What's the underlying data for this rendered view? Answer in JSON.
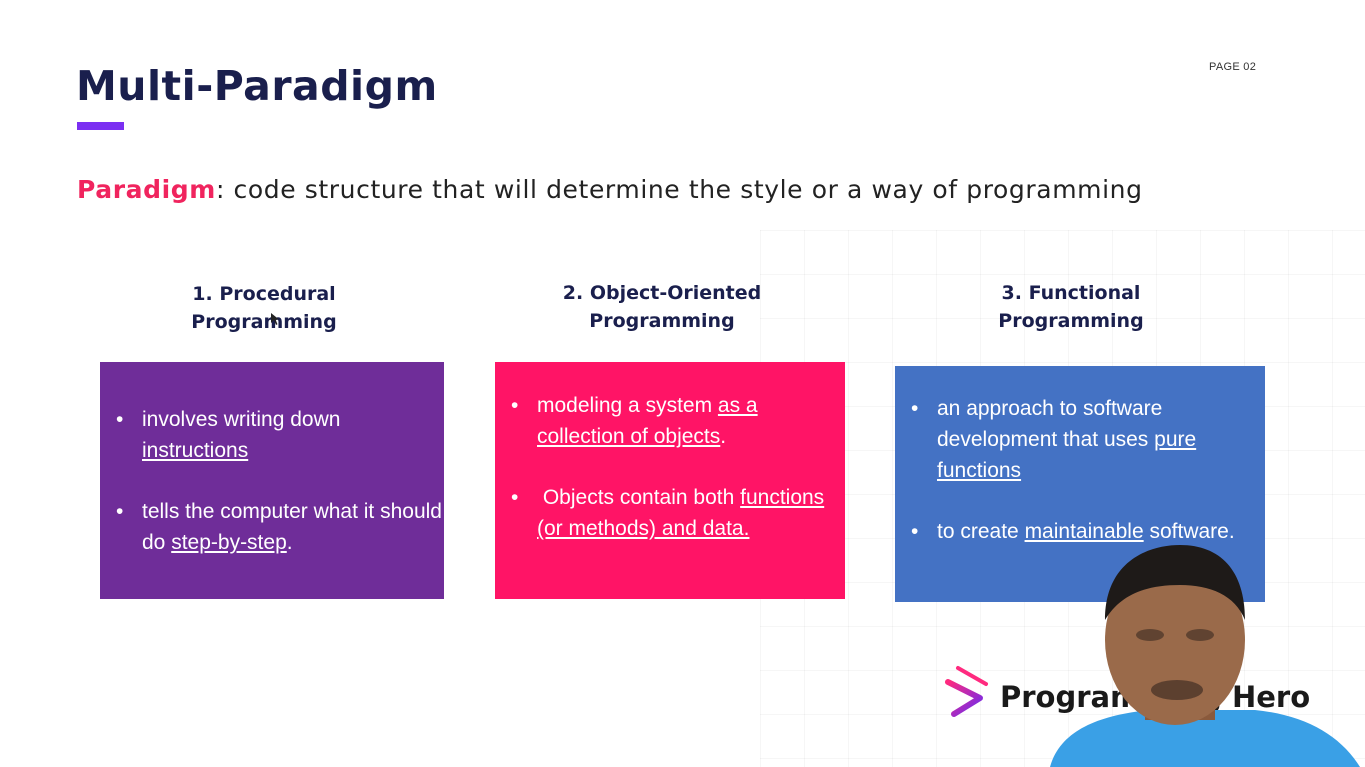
{
  "slide": {
    "title": "Multi-Paradigm",
    "page_label": "PAGE 02",
    "definition": {
      "term": "Paradigm",
      "text": ": code structure that will determine the style or a way of programming"
    }
  },
  "columns": [
    {
      "heading_line1": "1. Procedural",
      "heading_line2": "Programming",
      "color": "#6f2d99",
      "bullets": [
        {
          "plain": "involves writing down ",
          "link": "instructions",
          "after": ""
        },
        {
          "plain": "tells the computer what it should do ",
          "link": "step-by-step",
          "after": "."
        }
      ]
    },
    {
      "heading_line1": "2. Object-Oriented",
      "heading_line2": "Programming",
      "color": "#ff1466",
      "bullets": [
        {
          "plain": "modeling a system ",
          "link": "as a collection of objects",
          "after": "."
        },
        {
          "plain": " Objects contain both ",
          "link": "functions (or methods) and data.",
          "after": ""
        }
      ]
    },
    {
      "heading_line1": "3. Functional",
      "heading_line2": "Programming",
      "color": "#4472c4",
      "bullets": [
        {
          "plain": "an approach to software development that uses ",
          "link": "pure functions",
          "after": ""
        },
        {
          "plain": "to create ",
          "link": "maintainable",
          "after": " software."
        }
      ]
    }
  ],
  "brand": {
    "name": "Programming Hero",
    "accent": "#7b2ff2",
    "logo_icon": "play-logo-icon"
  },
  "colors": {
    "title": "#1a1f4d",
    "term": "#f0245e"
  }
}
